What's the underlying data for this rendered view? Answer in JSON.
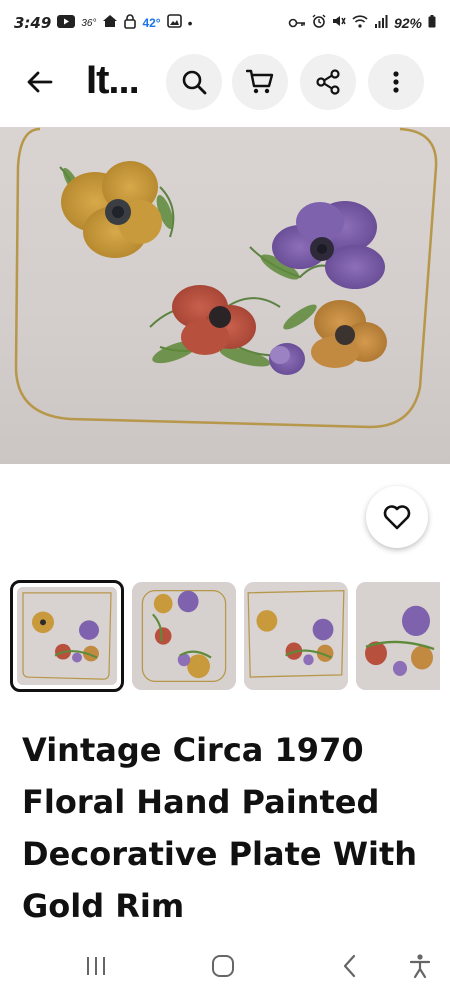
{
  "status_bar": {
    "time": "3:49",
    "youtube_temp": "36°",
    "weather_temp": "42°",
    "dot": "•",
    "battery": "92%"
  },
  "app_bar": {
    "title": "It..."
  },
  "icons": {
    "back": "arrow-left-icon",
    "search": "search-icon",
    "cart": "cart-icon",
    "share": "share-icon",
    "more": "more-vertical-icon",
    "favorite": "heart-icon"
  },
  "gallery": {
    "thumbnail_count": 4,
    "selected_index": 0
  },
  "item": {
    "title": "Vintage Circa 1970 Floral Hand Painted Decorative Plate With Gold Rim"
  },
  "colors": {
    "gold_rim": "#b7974a",
    "plate_bg": "#d8d2d0"
  }
}
